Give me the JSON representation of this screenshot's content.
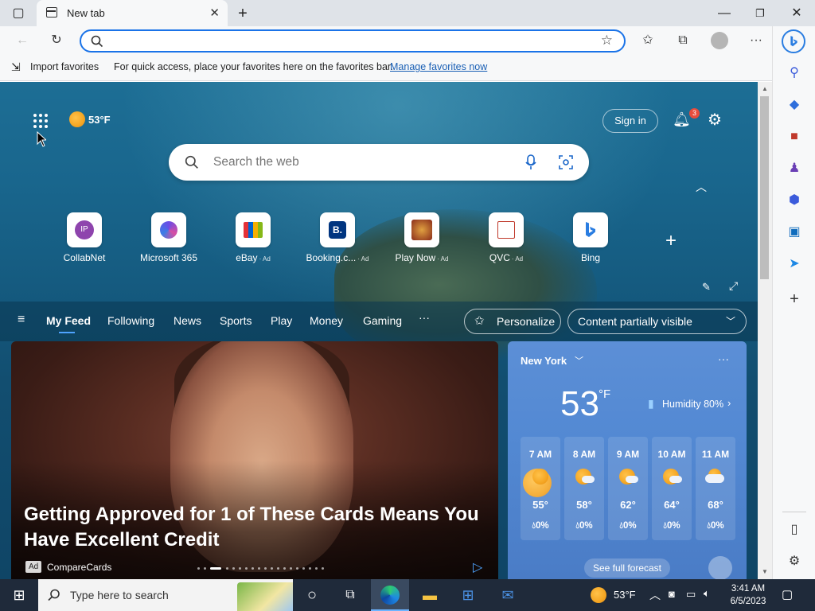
{
  "browser": {
    "tab_title": "New tab",
    "address_placeholder": "",
    "favorites_bar": {
      "import_label": "Import favorites",
      "message": "For quick access, place your favorites here on the favorites bar.",
      "manage_link": "Manage favorites now"
    }
  },
  "newtab": {
    "top_weather": {
      "temp": "53°F"
    },
    "signin_label": "Sign in",
    "notification_count": "3",
    "search_placeholder": "Search the web",
    "quicklinks": [
      {
        "label": "CollabNet",
        "ad": "",
        "initials": "IP"
      },
      {
        "label": "Microsoft 365",
        "ad": ""
      },
      {
        "label": "eBay",
        "ad": "· Ad"
      },
      {
        "label": "Booking.c...",
        "ad": "· Ad",
        "initials": "B."
      },
      {
        "label": "Play Now",
        "ad": "· Ad"
      },
      {
        "label": "QVC",
        "ad": "· Ad"
      },
      {
        "label": "Bing",
        "ad": ""
      }
    ],
    "feed_nav": {
      "items": [
        "My Feed",
        "Following",
        "News",
        "Sports",
        "Play",
        "Money",
        "Gaming"
      ],
      "more": "···",
      "personalize": "Personalize",
      "visibility": "Content partially visible"
    },
    "hero": {
      "title": "Getting Approved for 1 of These Cards Means You Have Excellent Credit",
      "ad_badge": "Ad",
      "source": "CompareCards"
    },
    "weather_card": {
      "city": "New York",
      "temp": "53",
      "unit": "°F",
      "humidity": "Humidity 80%",
      "hours": [
        {
          "time": "7 AM",
          "temp": "55°",
          "precip": "0%"
        },
        {
          "time": "8 AM",
          "temp": "58°",
          "precip": "0%"
        },
        {
          "time": "9 AM",
          "temp": "62°",
          "precip": "0%"
        },
        {
          "time": "10 AM",
          "temp": "64°",
          "precip": "0%"
        },
        {
          "time": "11 AM",
          "temp": "68°",
          "precip": "0%"
        }
      ],
      "forecast_button": "See full forecast"
    }
  },
  "taskbar": {
    "search_placeholder": "Type here to search",
    "weather": "53°F",
    "time": "3:41 AM",
    "date": "6/5/2023"
  }
}
